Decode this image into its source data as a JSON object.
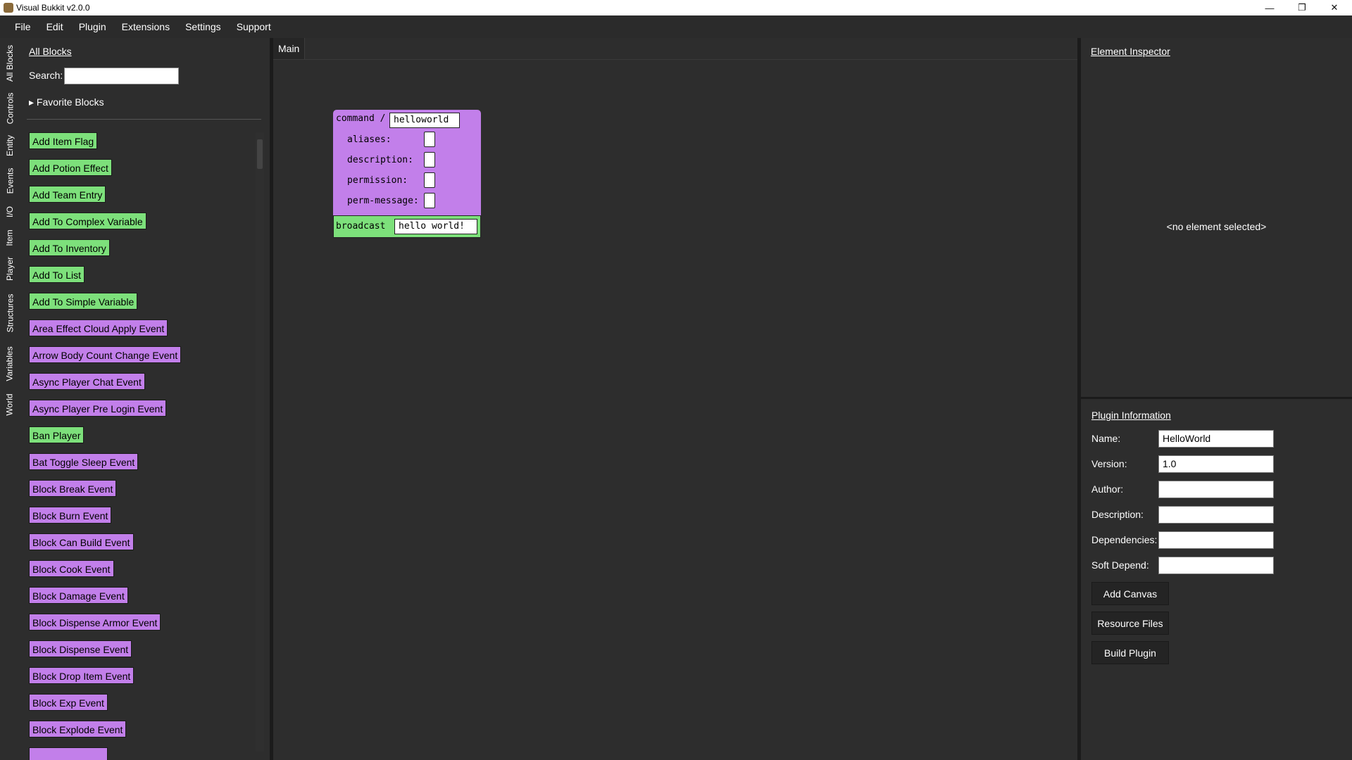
{
  "window": {
    "title": "Visual Bukkit v2.0.0",
    "controls": {
      "minimize": "—",
      "restore": "❐",
      "close": "✕"
    }
  },
  "menu": [
    "File",
    "Edit",
    "Plugin",
    "Extensions",
    "Settings",
    "Support"
  ],
  "side_tabs": [
    "All Blocks",
    "Controls",
    "Entity",
    "Events",
    "I/O",
    "Item",
    "Player",
    "Structures",
    "Variables",
    "World"
  ],
  "palette": {
    "title": "All Blocks",
    "search_label": "Search:",
    "search_value": "",
    "favorites_label": "▸ Favorite Blocks",
    "blocks": [
      {
        "label": "Add Item Flag",
        "color": "green"
      },
      {
        "label": "Add Potion Effect",
        "color": "green"
      },
      {
        "label": "Add Team Entry",
        "color": "green"
      },
      {
        "label": "Add To Complex Variable",
        "color": "green"
      },
      {
        "label": "Add To Inventory",
        "color": "green"
      },
      {
        "label": "Add To List",
        "color": "green"
      },
      {
        "label": "Add To Simple Variable",
        "color": "green"
      },
      {
        "label": "Area Effect Cloud Apply Event",
        "color": "purple"
      },
      {
        "label": "Arrow Body Count Change Event",
        "color": "purple"
      },
      {
        "label": "Async Player Chat Event",
        "color": "purple"
      },
      {
        "label": "Async Player Pre Login Event",
        "color": "purple"
      },
      {
        "label": "Ban Player",
        "color": "green"
      },
      {
        "label": "Bat Toggle Sleep Event",
        "color": "purple"
      },
      {
        "label": "Block Break Event",
        "color": "purple"
      },
      {
        "label": "Block Burn Event",
        "color": "purple"
      },
      {
        "label": "Block Can Build Event",
        "color": "purple"
      },
      {
        "label": "Block Cook Event",
        "color": "purple"
      },
      {
        "label": "Block Damage Event",
        "color": "purple"
      },
      {
        "label": "Block Dispense Armor Event",
        "color": "purple"
      },
      {
        "label": "Block Dispense Event",
        "color": "purple"
      },
      {
        "label": "Block Drop Item Event",
        "color": "purple"
      },
      {
        "label": "Block Exp Event",
        "color": "purple"
      },
      {
        "label": "Block Explode Event",
        "color": "purple"
      }
    ]
  },
  "canvas": {
    "tab": "Main",
    "command_block": {
      "prefix": "command /",
      "command": "helloworld",
      "fields": [
        "aliases:",
        "description:",
        "permission:",
        "perm-message:"
      ]
    },
    "broadcast_block": {
      "label": "broadcast",
      "value": "hello world!"
    }
  },
  "inspector": {
    "title": "Element Inspector",
    "empty_text": "<no element selected>"
  },
  "plugin_info": {
    "title": "Plugin Information",
    "fields": [
      {
        "label": "Name:",
        "value": "HelloWorld"
      },
      {
        "label": "Version:",
        "value": "1.0"
      },
      {
        "label": "Author:",
        "value": ""
      },
      {
        "label": "Description:",
        "value": ""
      },
      {
        "label": "Dependencies:",
        "value": ""
      },
      {
        "label": "Soft Depend:",
        "value": ""
      }
    ],
    "buttons": [
      "Add Canvas",
      "Resource Files",
      "Build Plugin"
    ]
  },
  "colors": {
    "green_block": "#7de07b",
    "purple_block": "#c27fea",
    "background": "#2d2d2d"
  }
}
